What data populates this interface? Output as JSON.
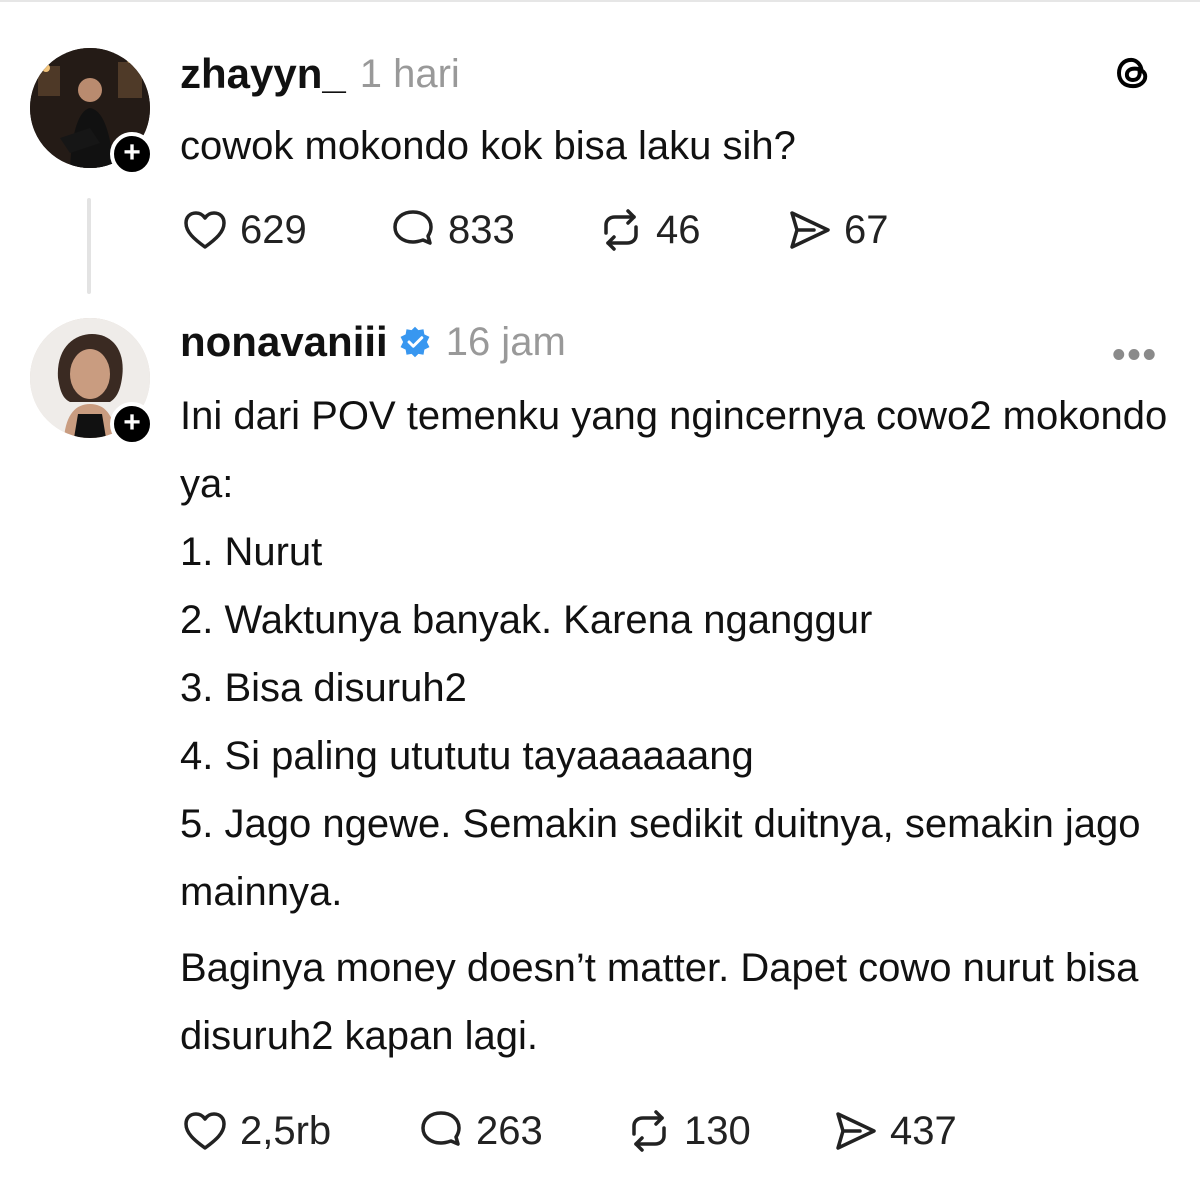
{
  "post1": {
    "username": "zhayyn_",
    "time": "1 hari",
    "text": "cowok mokondo kok bisa laku sih?",
    "stats": {
      "likes": "629",
      "replies": "833",
      "reposts": "46",
      "shares": "67"
    }
  },
  "post2": {
    "username": "nonavaniii",
    "time": "16 jam",
    "lines": [
      "Ini dari POV temenku yang ngincernya cowo2 mokondo ya:",
      "1. Nurut",
      "2. Waktunya banyak. Karena nganggur",
      "3. Bisa disuruh2",
      "4. Si paling utututu tayaaaaaang",
      "5. Jago ngewe. Semakin sedikit duitnya, semakin jago mainnya."
    ],
    "closing": "Baginya money doesn’t matter. Dapet cowo nurut bisa disuruh2 kapan lagi.",
    "stats": {
      "likes": "2,5rb",
      "replies": "263",
      "reposts": "130",
      "shares": "437"
    }
  },
  "ui": {
    "follow_symbol": "+",
    "more_symbol": "•••",
    "accent_color": "#3897f0",
    "icons": [
      "heart-icon",
      "comment-icon",
      "repost-icon",
      "share-icon",
      "threads-logo-icon",
      "verified-badge-icon"
    ]
  }
}
